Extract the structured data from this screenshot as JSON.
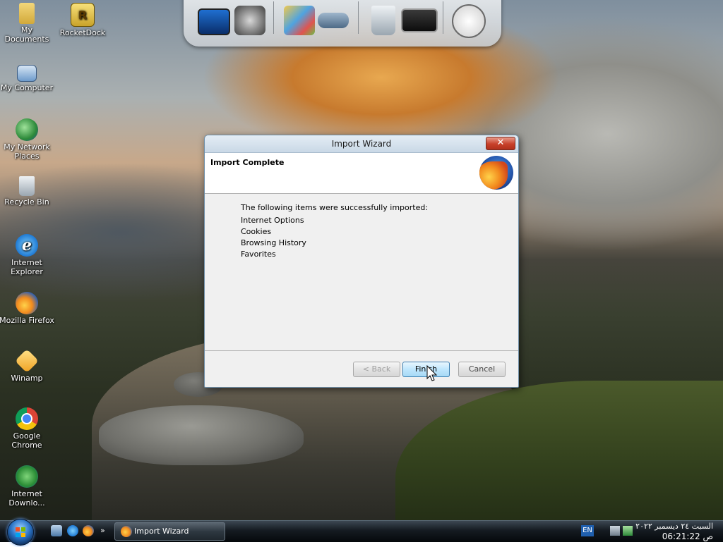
{
  "desktop_icons": [
    {
      "label": "My Documents",
      "icon": "folder-documents-icon"
    },
    {
      "label": "RocketDock",
      "icon": "rocketdock-icon"
    },
    {
      "label": "My Computer",
      "icon": "computer-icon"
    },
    {
      "label": "My Network Places",
      "icon": "network-places-icon"
    },
    {
      "label": "Recycle Bin",
      "icon": "recycle-bin-icon"
    },
    {
      "label": "Internet Explorer",
      "icon": "internet-explorer-icon"
    },
    {
      "label": "Mozilla Firefox",
      "icon": "firefox-icon"
    },
    {
      "label": "Winamp",
      "icon": "winamp-icon"
    },
    {
      "label": "Google Chrome",
      "icon": "chrome-icon"
    },
    {
      "label": "Internet Downlo...",
      "icon": "internet-download-manager-icon"
    }
  ],
  "dock": {
    "items": [
      "monitor-icon",
      "settings-gear-icon",
      "control-panel-icon",
      "drive-icon",
      "recycle-bin-icon",
      "display-icon",
      "clock-icon"
    ]
  },
  "dialog": {
    "title": "Import Wizard",
    "close_label": "✕",
    "header_title": "Import Complete",
    "intro": "The following items were successfully imported:",
    "items": [
      "Internet Options",
      "Cookies",
      "Browsing History",
      "Favorites"
    ],
    "back_label": "< Back",
    "finish_label": "Finish",
    "cancel_label": "Cancel"
  },
  "taskbar": {
    "task_label": "Import Wizard",
    "language": "EN",
    "date": "السبت ٢٤ ديسمبر ٢٠٢٢",
    "time": "06:21:22 ص"
  },
  "colors": {
    "dialog_bg": "#f0f0f0",
    "title_gradient": "#c9d8e6",
    "close_red": "#c7402a",
    "primary_button": "#bee6fd",
    "taskbar": "#151b21"
  }
}
